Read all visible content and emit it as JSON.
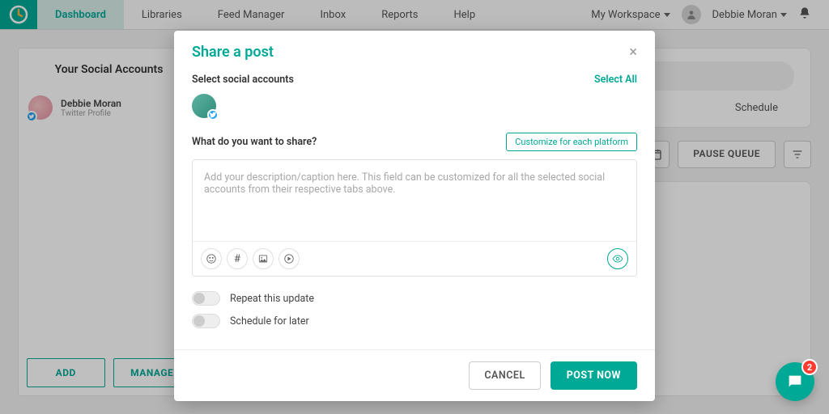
{
  "nav": {
    "items": [
      "Dashboard",
      "Libraries",
      "Feed Manager",
      "Inbox",
      "Reports",
      "Help"
    ],
    "active_index": 0
  },
  "topbar": {
    "workspace": "My Workspace",
    "user": "Debbie Moran"
  },
  "sidebar": {
    "title": "Your Social Accounts",
    "account": {
      "name": "Debbie Moran",
      "subtitle": "Twitter Profile"
    },
    "buttons": {
      "add": "ADD",
      "manage": "MANAGE"
    }
  },
  "main": {
    "tabs": [
      "Schedule"
    ],
    "pause": "PAUSE QUEUE"
  },
  "modal": {
    "title": "Share a post",
    "select_label": "Select social accounts",
    "select_all": "Select All",
    "what_label": "What do you want to share?",
    "customize": "Customize for each platform",
    "placeholder": "Add your description/caption here. This field can be customized for all the selected social accounts from their respective tabs above.",
    "toggle_repeat": "Repeat this update",
    "toggle_schedule": "Schedule for later",
    "cancel": "CANCEL",
    "submit": "POST NOW"
  },
  "chat": {
    "count": "2"
  },
  "colors": {
    "accent": "#00a996"
  }
}
